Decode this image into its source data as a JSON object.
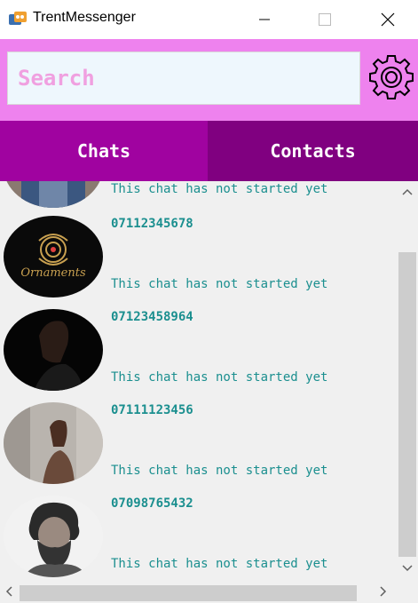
{
  "window": {
    "title": "TrentMessenger",
    "app_icon": "messenger-app-icon"
  },
  "search": {
    "placeholder": "Search",
    "value": ""
  },
  "settings": {
    "icon": "gear-icon"
  },
  "tabs": [
    {
      "label": "Chats",
      "active": false,
      "color": "#a003a0"
    },
    {
      "label": "Contacts",
      "active": true,
      "color": "#800080"
    }
  ],
  "colors": {
    "header_bg": "#ee82ee",
    "list_bg": "#f0f0f0",
    "text_accent": "#1b8f8f"
  },
  "chats": [
    {
      "name": "",
      "status": "This chat has not started yet",
      "avatar": "person-jacket-avatar"
    },
    {
      "name": "07112345678",
      "status": "This chat has not started yet",
      "avatar": "ornaments-logo-avatar"
    },
    {
      "name": "07123458964",
      "status": "This chat has not started yet",
      "avatar": "woman-dark-background-avatar"
    },
    {
      "name": "07111123456",
      "status": "This chat has not started yet",
      "avatar": "woman-wall-avatar"
    },
    {
      "name": "07098765432",
      "status": "This chat has not started yet",
      "avatar": "bearded-man-avatar"
    }
  ],
  "avatar_logo_text": "Ornaments"
}
